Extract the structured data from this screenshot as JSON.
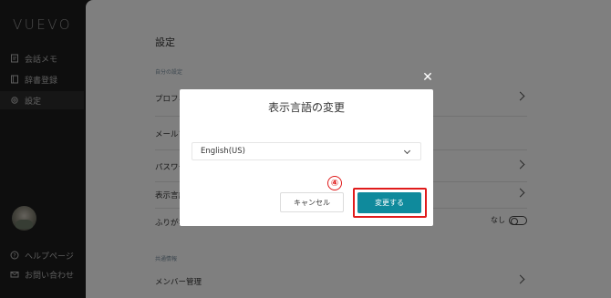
{
  "app": {
    "logo": "VUEVO"
  },
  "sidebar": {
    "items": [
      {
        "label": "会話メモ",
        "icon": "memo-icon"
      },
      {
        "label": "辞書登録",
        "icon": "book-icon"
      },
      {
        "label": "設定",
        "icon": "gear-icon",
        "active": true
      }
    ],
    "bottom_items": [
      {
        "label": "ヘルプページ",
        "icon": "help-icon"
      },
      {
        "label": "お問い合わせ",
        "icon": "mail-icon"
      }
    ]
  },
  "settings": {
    "title": "設定",
    "personal_section_label": "自分の設定",
    "rows": [
      {
        "label": "プロフィ"
      },
      {
        "label": "メールア"
      },
      {
        "label": "パスワー"
      },
      {
        "label": "表示言語"
      },
      {
        "label": "ふりがな",
        "toggle_label": "なし"
      }
    ],
    "common_section_label": "共通情報",
    "member_row": "メンバー管理"
  },
  "modal": {
    "title": "表示言語の変更",
    "select_value": "English(US)",
    "cancel_label": "キャンセル",
    "submit_label": "変更する",
    "close_symbol": "✕"
  },
  "annotation": {
    "step_number": "④",
    "color": "#e01b1b"
  },
  "colors": {
    "accent": "#0f8a9c",
    "sidebar_bg": "#1c1c1c"
  }
}
